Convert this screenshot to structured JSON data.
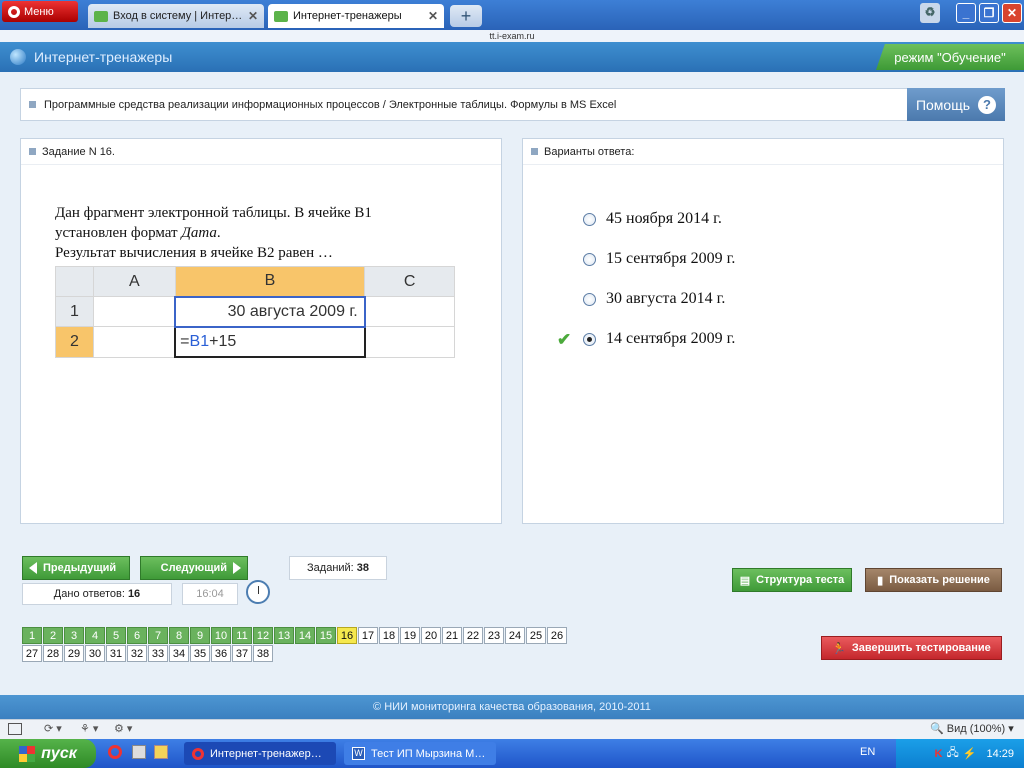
{
  "browser": {
    "menu_label": "Меню",
    "tabs": [
      {
        "title": "Вход в систему | Интер…",
        "active": false
      },
      {
        "title": "Интернет-тренажеры",
        "active": true
      }
    ],
    "url": "tt.i-exam.ru",
    "zoom": "Вид (100%)"
  },
  "app": {
    "title": "Интернет-тренажеры",
    "mode": "режим \"Обучение\"",
    "breadcrumb": "Программные средства реализации информационных процессов / Электронные таблицы. Формулы в MS Excel",
    "help_label": "Помощь",
    "help_icon": "?"
  },
  "task": {
    "header": "Задание N 16.",
    "line1": "Дан фрагмент электронной таблицы. В ячейке B1",
    "line2_prefix": "установлен формат ",
    "line2_italic": "Дата",
    "line2_suffix": ".",
    "line3": "Результат вычисления в ячейке B2 равен …",
    "sheet": {
      "col_a": "A",
      "col_b": "B",
      "col_c": "C",
      "row1": "1",
      "row2": "2",
      "b1": "30 августа 2009 г.",
      "b2_eq": "=",
      "b2_ref": "B1",
      "b2_rest": "+15"
    }
  },
  "answers": {
    "header": "Варианты ответа:",
    "options": [
      {
        "label": "45 ноября 2014 г.",
        "selected": false
      },
      {
        "label": "15 сентября 2009 г.",
        "selected": false
      },
      {
        "label": "30 августа 2014 г.",
        "selected": false
      },
      {
        "label": "14 сентября 2009 г.",
        "selected": true,
        "correct": true
      }
    ]
  },
  "controls": {
    "prev_label": "Предыдущий",
    "next_label": "Следующий",
    "tasks_label": "Заданий:",
    "tasks_count": "38",
    "answers_label": "Дано ответов:",
    "answers_count": "16",
    "timer": "16:04",
    "structure_label": "Структура теста",
    "solution_label": "Показать решение",
    "finish_label": "Завершить тестирование",
    "current_task": 16,
    "answered_tasks": 15,
    "total_tasks": 38,
    "numbers": [
      "1",
      "2",
      "3",
      "4",
      "5",
      "6",
      "7",
      "8",
      "9",
      "10",
      "11",
      "12",
      "13",
      "14",
      "15",
      "16",
      "17",
      "18",
      "19",
      "20",
      "21",
      "22",
      "23",
      "24",
      "25",
      "26",
      "27",
      "28",
      "29",
      "30",
      "31",
      "32",
      "33",
      "34",
      "35",
      "36",
      "37",
      "38"
    ]
  },
  "footer": "© НИИ мониторинга качества образования, 2010-2011",
  "taskbar": {
    "start_label": "пуск",
    "tasks": [
      "Интернет-тренажер…",
      "Тест ИП Мырзина М…"
    ],
    "lang": "EN",
    "time": "14:29"
  },
  "colors": {
    "accent_blue": "#3e8fd0",
    "green": "#4caa3c",
    "finish_red": "#d9363b",
    "solution_brown": "#8a6a50",
    "current_yellow": "#f5e84d"
  }
}
